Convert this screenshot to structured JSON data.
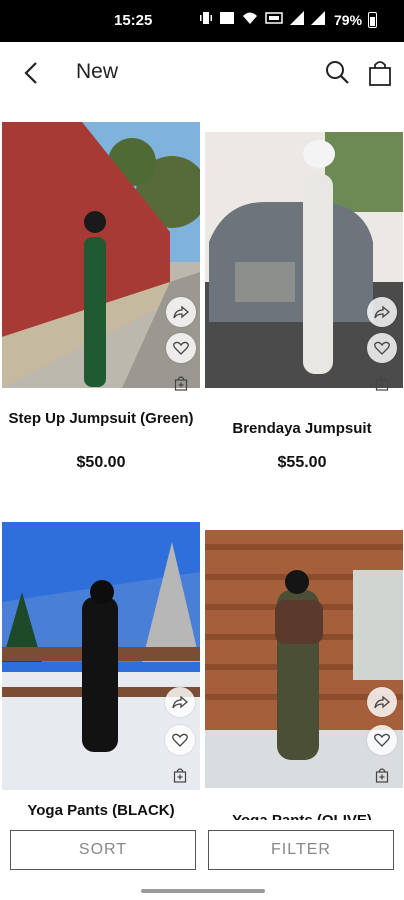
{
  "status_bar": {
    "time": "15:25",
    "battery": "79%"
  },
  "header": {
    "title": "New"
  },
  "products": [
    {
      "name": "Step Up Jumpsuit (Green)",
      "price": "$50.00"
    },
    {
      "name": "Brendaya Jumpsuit",
      "price": "$55.00"
    },
    {
      "name": "Yoga Pants (BLACK)",
      "price": ""
    },
    {
      "name": "Yoga Pants (OLIVE)",
      "price": ""
    }
  ],
  "footer": {
    "sort_label": "SORT",
    "filter_label": "FILTER"
  }
}
